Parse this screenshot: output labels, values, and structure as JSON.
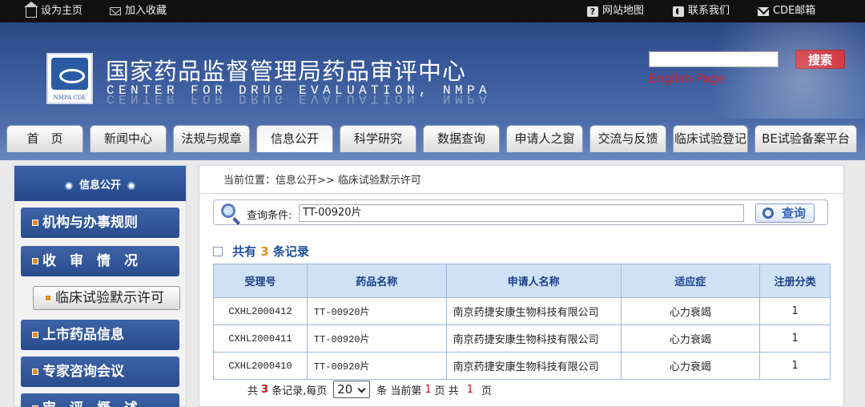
{
  "topbar": {
    "set_home": "设为主页",
    "add_fav": "加入收藏",
    "sitemap": "网站地图",
    "contact": "联系我们",
    "cde_mail": "CDE邮箱"
  },
  "header": {
    "title": "国家药品监督管理局药品审评中心",
    "subtitle": "CENTER FOR DRUG EVALUATION, NMPA",
    "logo_text": "NMPA CDE",
    "search_placeholder": "",
    "search_button": "搜索",
    "english_link": "English Page",
    "brand_color": "#2c4886",
    "accent_color": "#c8101c"
  },
  "nav": {
    "tabs": [
      {
        "label": "首　页"
      },
      {
        "label": "新闻中心"
      },
      {
        "label": "法规与规章"
      },
      {
        "label": "信息公开"
      },
      {
        "label": "科学研究"
      },
      {
        "label": "数据查询"
      },
      {
        "label": "申请人之窗"
      },
      {
        "label": "交流与反馈"
      },
      {
        "label": "临床试验登记"
      },
      {
        "label": "BE试验备案平台"
      }
    ],
    "active": "信息公开"
  },
  "sidebar": {
    "title": "信息公开",
    "items": [
      {
        "label": "机构与办事规则"
      },
      {
        "label": "收　审　情　况"
      },
      {
        "label": "临床试验默示许可"
      },
      {
        "label": "上市药品信息"
      },
      {
        "label": "专家咨询会议"
      },
      {
        "label": "审　评　概　述"
      }
    ]
  },
  "main": {
    "breadcrumb": "当前位置：信息公开>> 临床试验默示许可",
    "query_label": "查询条件:",
    "query_value": "TT-00920片",
    "query_button": "查询",
    "count_prefix": "共有",
    "count_value": "3",
    "count_suffix": "条记录",
    "table": {
      "headers": [
        "受理号",
        "药品名称",
        "申请人名称",
        "适应症",
        "注册分类"
      ],
      "rows": [
        [
          "CXHL2000412",
          "TT-00920片",
          "南京药捷安康生物科技有限公司",
          "心力衰竭",
          "1"
        ],
        [
          "CXHL2000411",
          "TT-00920片",
          "南京药捷安康生物科技有限公司",
          "心力衰竭",
          "1"
        ],
        [
          "CXHL2000410",
          "TT-00920片",
          "南京药捷安康生物科技有限公司",
          "心力衰竭",
          "1"
        ]
      ]
    },
    "pager": {
      "text1": "共",
      "total": "3",
      "text2": "条记录,每页",
      "per_page": "20",
      "text3": "条 当前第",
      "current": "1",
      "text4": "页 共",
      "pages": "1",
      "text5": "页"
    }
  }
}
